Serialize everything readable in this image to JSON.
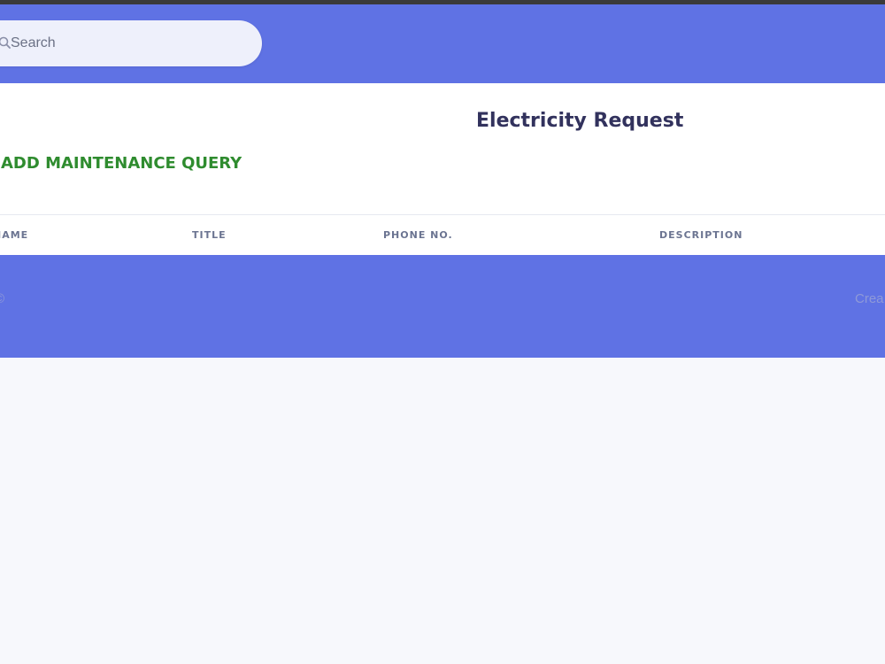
{
  "search": {
    "placeholder": "Search",
    "value": ""
  },
  "page": {
    "title": "Electricity Request",
    "add_link_label": "ADD MAINTENANCE QUERY"
  },
  "table": {
    "columns": [
      "NAME",
      "TITLE",
      "PHONE NO.",
      "DESCRIPTION"
    ],
    "rows": []
  },
  "footer": {
    "left_text": "©",
    "right_text": "Crea"
  },
  "colors": {
    "header_bg": "#5f72e4",
    "add_link": "#2f8c2f",
    "title": "#32325d"
  }
}
